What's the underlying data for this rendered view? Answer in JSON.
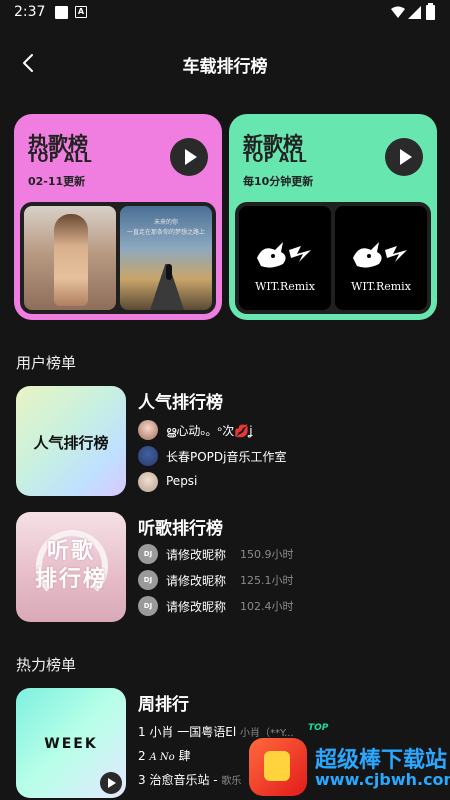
{
  "status_bar": {
    "time": "2:37"
  },
  "header": {
    "title": "车载排行榜"
  },
  "featured": [
    {
      "title": "热歌榜",
      "subtitle": "TOP ALL",
      "update": "02-11更新",
      "color": "#f07ee0",
      "thumb2_text": "未来的你\n一直走在那条你的梦想之路上"
    },
    {
      "title": "新歌榜",
      "subtitle": "TOP ALL",
      "update": "毎10分钟更新",
      "color": "#67e6b0",
      "thumb_text": "WIT.Remix"
    }
  ],
  "sections": {
    "user": "用户榜单",
    "hot": "热力榜单"
  },
  "user_charts": [
    {
      "title": "人气排行榜",
      "cover_text": "人气排行榜",
      "entries": [
        {
          "name": "ൠ心动ₒ。ᵒ次💋ʝ"
        },
        {
          "name": "长春POPDj音乐工作室"
        },
        {
          "name": "Pepsi"
        }
      ]
    },
    {
      "title": "听歌排行榜",
      "cover_text": "听歌\n排行榜",
      "entries": [
        {
          "avatar": "DJ",
          "name": "请修改昵称",
          "duration": "150.9小时"
        },
        {
          "avatar": "DJ",
          "name": "请修改昵称",
          "duration": "125.1小时"
        },
        {
          "avatar": "DJ",
          "name": "请修改昵称",
          "duration": "102.4小时"
        }
      ]
    }
  ],
  "hot_charts": [
    {
      "title": "周排行",
      "cover_text": "WEEK",
      "entries": [
        {
          "text": "1 小肖 一国粤语El ",
          "artist": "小肖（**Y...",
          "badge": "TOP"
        },
        {
          "text": "2 ",
          "stylized": "A No",
          "text2": " 肆"
        },
        {
          "text": "3 治愈音乐站 - ",
          "artist": "歌乐"
        }
      ]
    }
  ],
  "watermark": {
    "name": "超级棒下载站",
    "url": "www.cjbwh.com"
  },
  "icons": [
    "back-arrow-icon",
    "play-icon",
    "wifi-icon",
    "cellular-icon",
    "battery-icon"
  ]
}
